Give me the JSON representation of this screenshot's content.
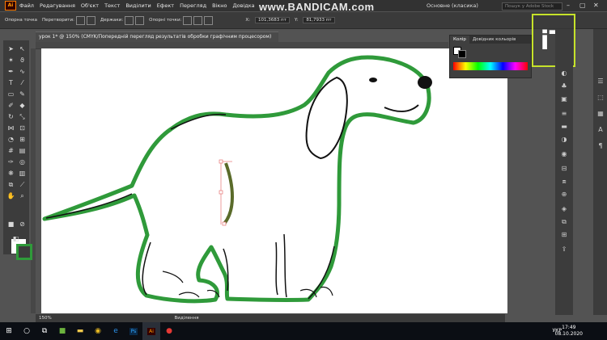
{
  "app": {
    "logo_text": "Ai"
  },
  "menubar": {
    "items": [
      "Файл",
      "Редагування",
      "Об'єкт",
      "Текст",
      "Виділити",
      "Ефект",
      "Перегляд",
      "Вікно",
      "Довідка"
    ],
    "workspace": "Основне (класика)",
    "search_placeholder": "Пошук у Adobe Stock"
  },
  "watermark": "www.BANDICAM.com",
  "controlbar": {
    "anchor_label": "Опорна точка",
    "convert_label": "Перетворити:",
    "handles_label": "Держаки:",
    "anchor2_label": "Опорні точки:",
    "x_value": "101,3683 пт",
    "y_value": "81,7933 пт"
  },
  "document": {
    "tab_title": "урок 1* @ 150% (CMYK/Попередній перегляд результатів обробки графічним процесором)",
    "zoom": "150%",
    "status": "Виділення"
  },
  "colorpanel": {
    "tab_active": "Колір",
    "tab_other": "Довідник кольорів"
  },
  "overlay_logo": "iT",
  "colors": {
    "stroke": "#2f9a3a",
    "logo_border": "#c6e22a",
    "ai_orange": "#ff7c00"
  },
  "taskbar": {
    "lang": "УКР",
    "time": "17:49",
    "date": "08.10.2020"
  }
}
